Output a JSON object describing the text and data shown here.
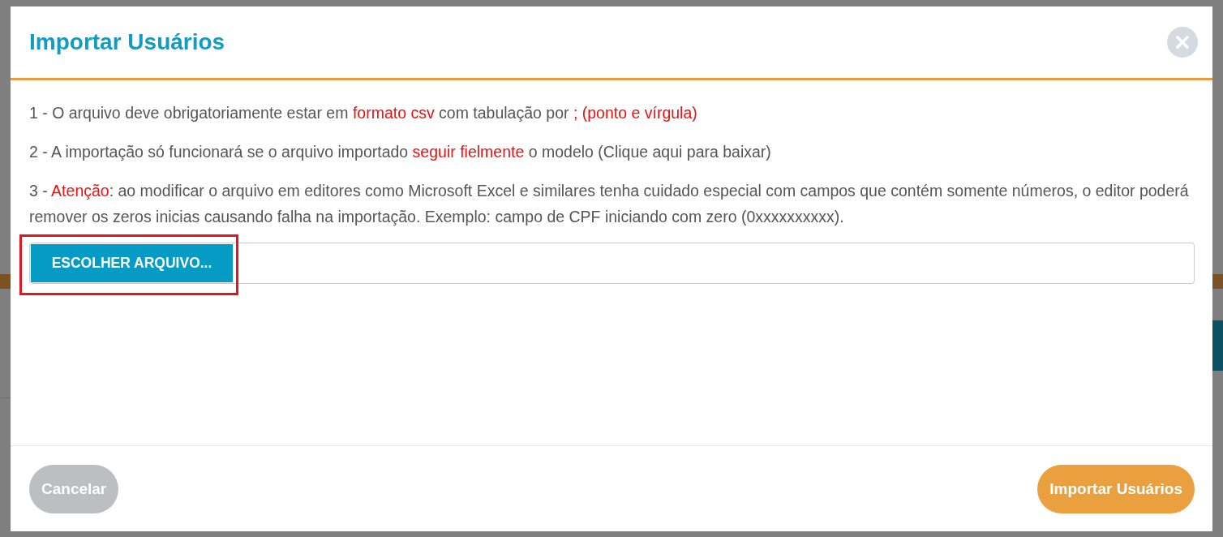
{
  "dialog": {
    "title": "Importar Usuários",
    "close_icon": "×",
    "instructions": [
      {
        "segments": [
          {
            "text": "1 - O arquivo deve obrigatoriamente estar em ",
            "highlight": false
          },
          {
            "text": "formato csv",
            "highlight": true
          },
          {
            "text": " com tabulação por ",
            "highlight": false
          },
          {
            "text": "; (ponto e vírgula)",
            "highlight": true
          }
        ]
      },
      {
        "segments": [
          {
            "text": "2 - A importação só funcionará se o arquivo importado ",
            "highlight": false
          },
          {
            "text": "seguir fielmente",
            "highlight": true
          },
          {
            "text": " o modelo (Clique aqui para baixar)",
            "highlight": false
          }
        ]
      },
      {
        "segments": [
          {
            "text": "3 - ",
            "highlight": false
          },
          {
            "text": "Atenção",
            "highlight": true
          },
          {
            "text": ": ao modificar o arquivo em editores como Microsoft Excel e similares tenha cuidado especial com campos que contém somente números, o editor poderá remover os zeros inicias causando falha na importação. Exemplo: campo de CPF iniciando com zero (0xxxxxxxxxx).",
            "highlight": false
          }
        ]
      }
    ],
    "file_picker": {
      "button": "ESCOLHER ARQUIVO...",
      "highlighted": true
    },
    "buttons": [
      {
        "label": "Cancelar",
        "kind": "secondary"
      },
      {
        "label": "Importar Usuários",
        "kind": "primary"
      }
    ]
  }
}
